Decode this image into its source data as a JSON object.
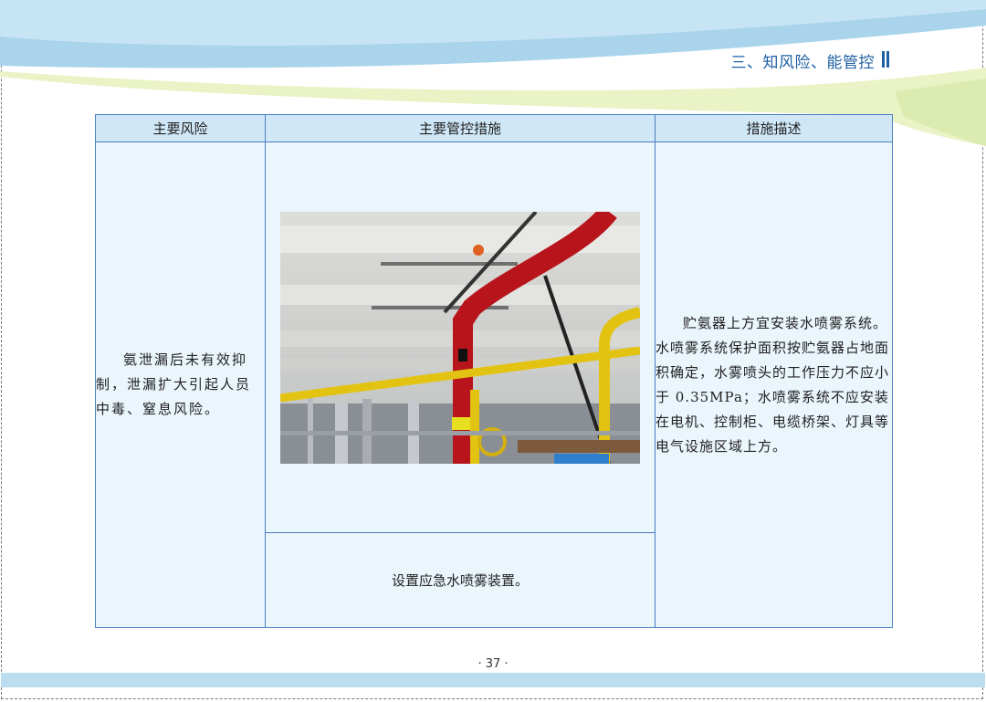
{
  "header": {
    "section_title": "三、知风险、能管控"
  },
  "table": {
    "headers": [
      "主要风险",
      "主要管控措施",
      "措施描述"
    ],
    "risk_text": "氨泄漏后未有效抑制，泄漏扩大引起人员中毒、窒息风险。",
    "measure_caption": "设置应急水喷雾装置。",
    "description": "贮氨器上方宜安装水喷雾系统。水喷雾系统保护面积按贮氨器占地面积确定，水雾喷头的工作压力不应小于 0.35MPa；水喷雾系统不应安装在电机、控制柜、电缆桥架、灯具等电气设施区域上方。"
  },
  "footer": {
    "page_number": "· 37 ·"
  },
  "colors": {
    "title_blue": "#1f5fa3",
    "header_fill": "#cfe7f7",
    "cell_fill": "#eaf5fc",
    "border_blue": "#4c7fc0",
    "band_blue": "#bcdcf0"
  }
}
